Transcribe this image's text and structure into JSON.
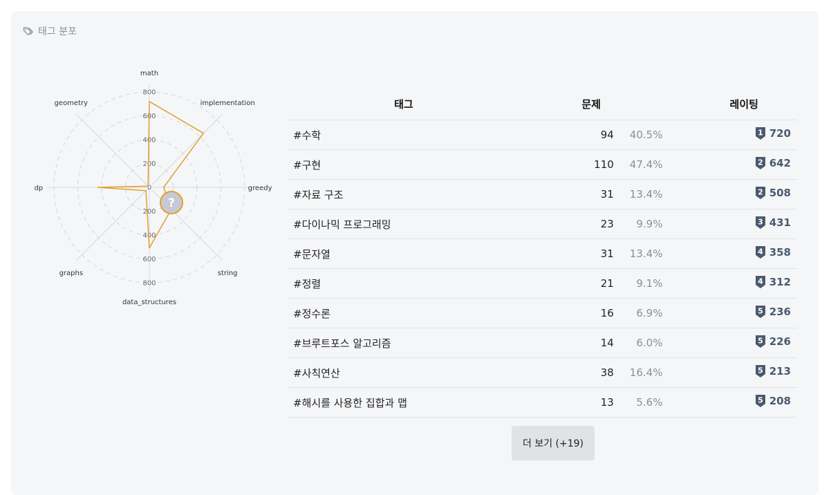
{
  "header": {
    "icon": "tags-icon",
    "title": "태그 분포"
  },
  "radar": {
    "labels": [
      "math",
      "implementation",
      "greedy",
      "string",
      "data_structures",
      "graphs",
      "dp",
      "geometry"
    ],
    "tick_labels": [
      "0",
      "200",
      "400",
      "600",
      "800"
    ],
    "values": [
      720,
      642,
      120,
      260,
      508,
      40,
      431,
      15
    ],
    "max": 800,
    "line_color": "#e0a02a",
    "center_icon": "unknown-tier-icon",
    "center_color": "#c7c9d6"
  },
  "table": {
    "headers": {
      "tag": "태그",
      "count": "문제",
      "rating": "레이팅"
    },
    "rows": [
      {
        "tag": "#수학",
        "count": "94",
        "pct": "40.5%",
        "tier": "1",
        "rating": "720"
      },
      {
        "tag": "#구현",
        "count": "110",
        "pct": "47.4%",
        "tier": "2",
        "rating": "642"
      },
      {
        "tag": "#자료 구조",
        "count": "31",
        "pct": "13.4%",
        "tier": "2",
        "rating": "508"
      },
      {
        "tag": "#다이나믹 프로그래밍",
        "count": "23",
        "pct": "9.9%",
        "tier": "3",
        "rating": "431"
      },
      {
        "tag": "#문자열",
        "count": "31",
        "pct": "13.4%",
        "tier": "4",
        "rating": "358"
      },
      {
        "tag": "#정렬",
        "count": "21",
        "pct": "9.1%",
        "tier": "4",
        "rating": "312"
      },
      {
        "tag": "#정수론",
        "count": "16",
        "pct": "6.9%",
        "tier": "5",
        "rating": "236"
      },
      {
        "tag": "#브루트포스 알고리즘",
        "count": "14",
        "pct": "6.0%",
        "tier": "5",
        "rating": "226"
      },
      {
        "tag": "#사칙연산",
        "count": "38",
        "pct": "16.4%",
        "tier": "5",
        "rating": "213"
      },
      {
        "tag": "#해시를 사용한 집합과 맵",
        "count": "13",
        "pct": "5.6%",
        "tier": "5",
        "rating": "208"
      }
    ],
    "badge_color": "#4a5a6e"
  },
  "more_button": {
    "label": "더 보기 (+19)"
  }
}
